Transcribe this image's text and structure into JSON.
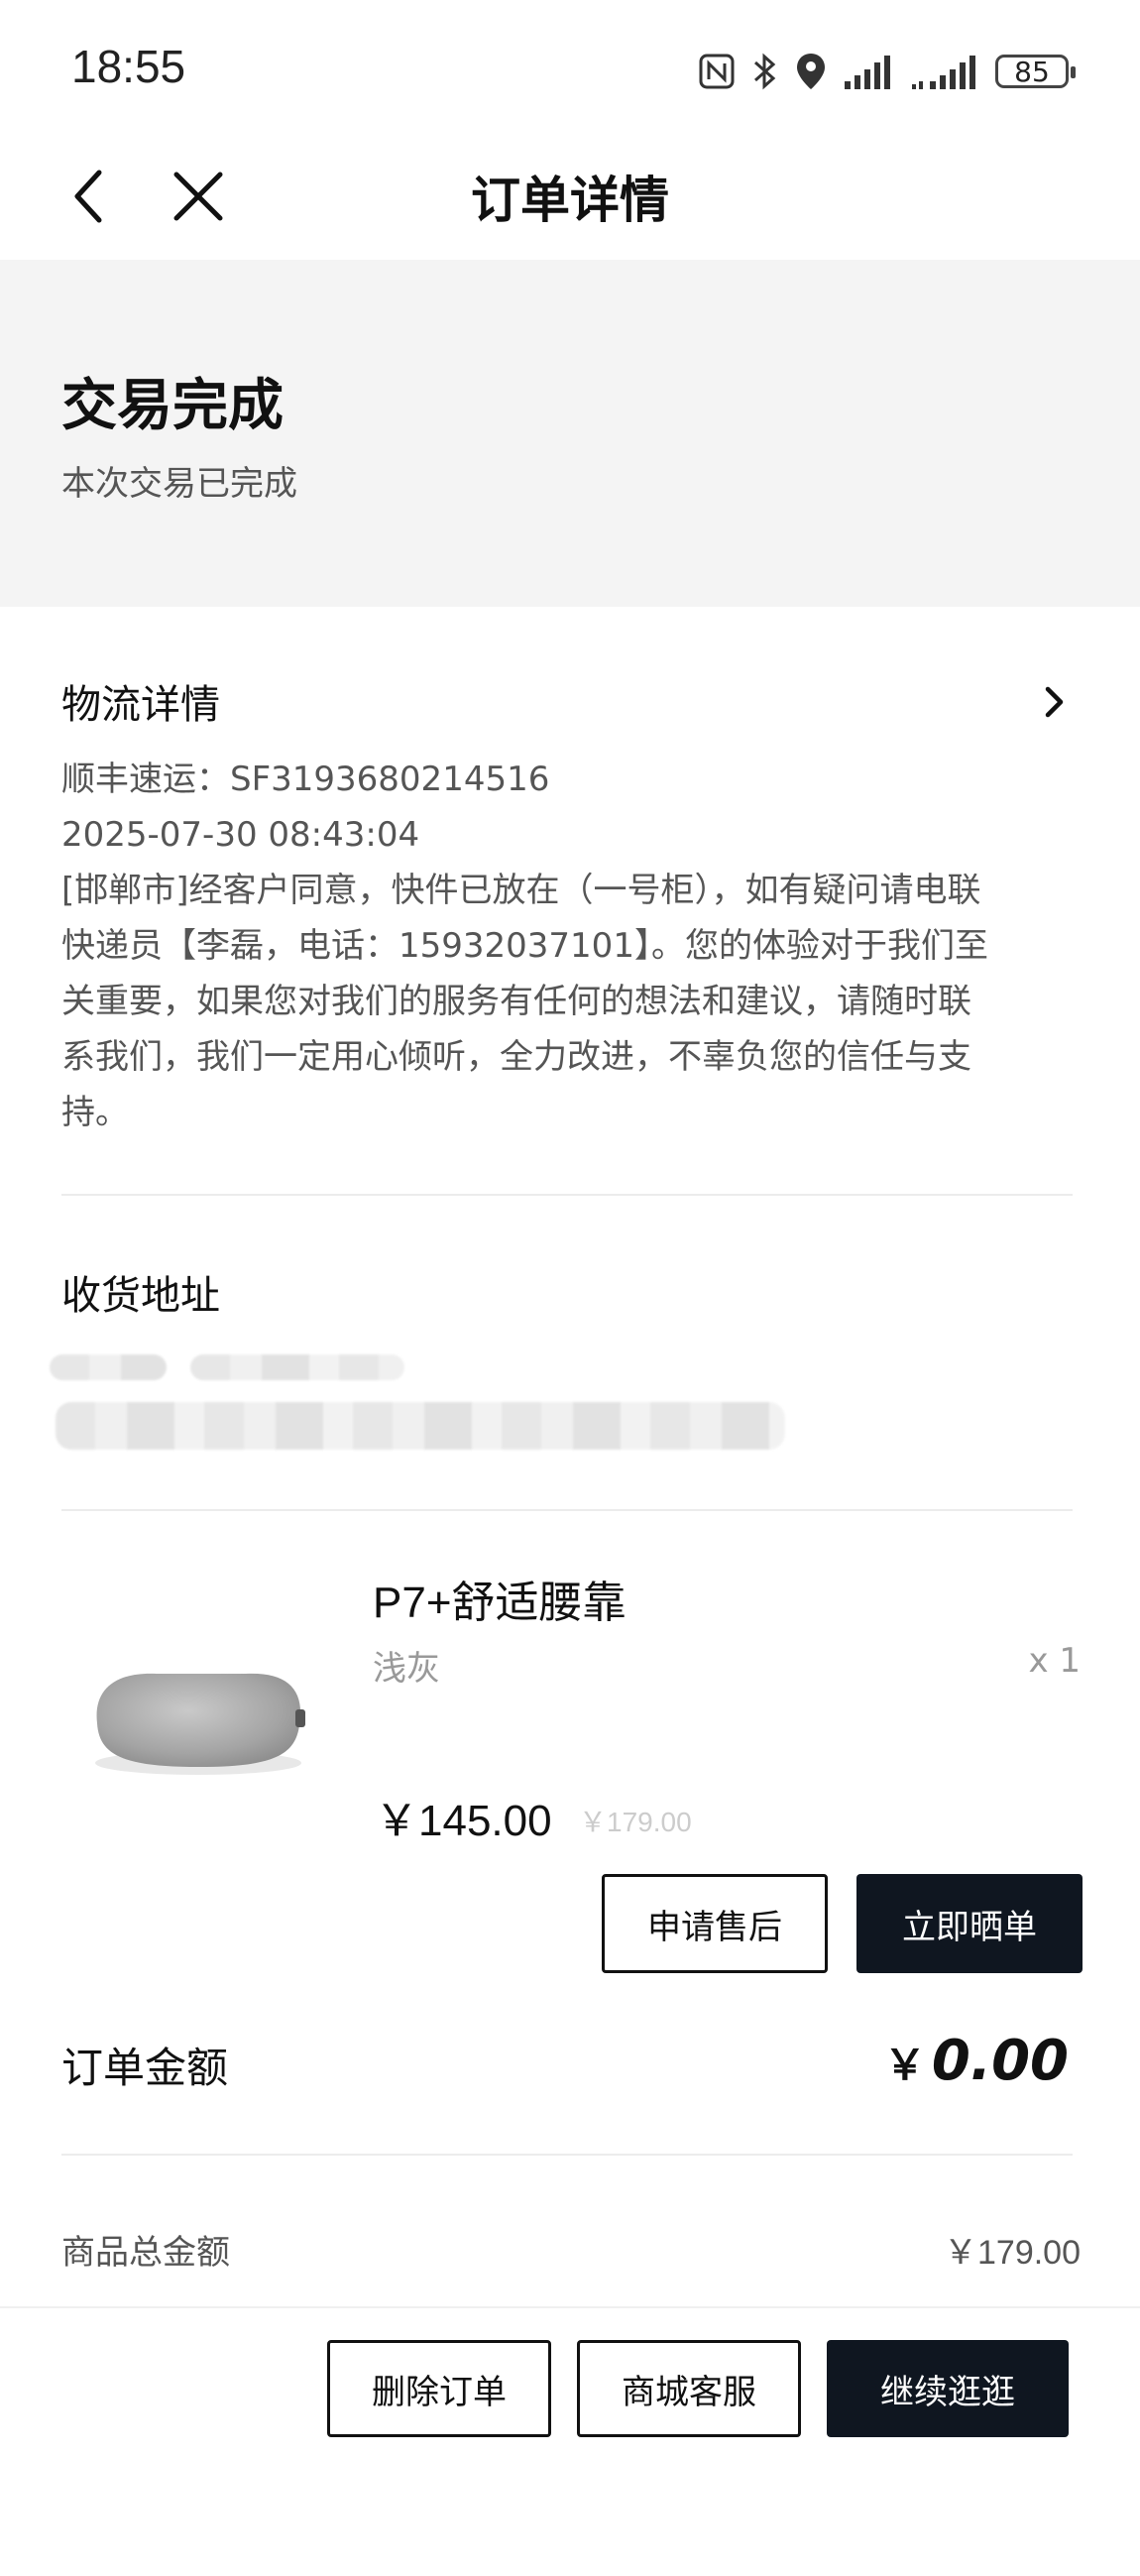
{
  "status_bar": {
    "time": "18:55",
    "battery": "85"
  },
  "nav": {
    "title": "订单详情"
  },
  "order_status": {
    "title": "交易完成",
    "subtitle": "本次交易已完成"
  },
  "logistics": {
    "title": "物流详情",
    "carrier_line": "顺丰速运：SF3193680214516",
    "timestamp": "2025-07-30 08:43:04",
    "message_lines": [
      "[邯郸市]经客户同意，快件已放在（一号柜），如有疑问请电联",
      "快递员【李磊，电话：15932037101】。您的体验对于我们至",
      "关重要，如果您对我们的服务有任何的想法和建议，请随时联",
      "系我们，我们一定用心倾听，全力改进，不辜负您的信任与支",
      "持。"
    ]
  },
  "address": {
    "title": "收货地址"
  },
  "product": {
    "name": "P7+舒适腰靠",
    "variant": "浅灰",
    "quantity": "x 1",
    "price": "￥145.00",
    "original_price": "￥179.00",
    "after_sale_label": "申请售后",
    "review_label": "立即晒单"
  },
  "order_amount": {
    "label": "订单金额",
    "currency": "￥",
    "value": "0.00"
  },
  "goods_total": {
    "label": "商品总金额",
    "value": "￥179.00"
  },
  "bottom_actions": {
    "delete_label": "删除订单",
    "service_label": "商城客服",
    "continue_label": "继续逛逛"
  },
  "colors": {
    "primary_button": "#0f1620",
    "banner_bg": "#f4f4f4"
  },
  "icons": [
    "nfc-icon",
    "bluetooth-icon",
    "location-icon",
    "signal-icon",
    "battery-icon",
    "back-icon",
    "close-icon",
    "chevron-right-icon"
  ]
}
